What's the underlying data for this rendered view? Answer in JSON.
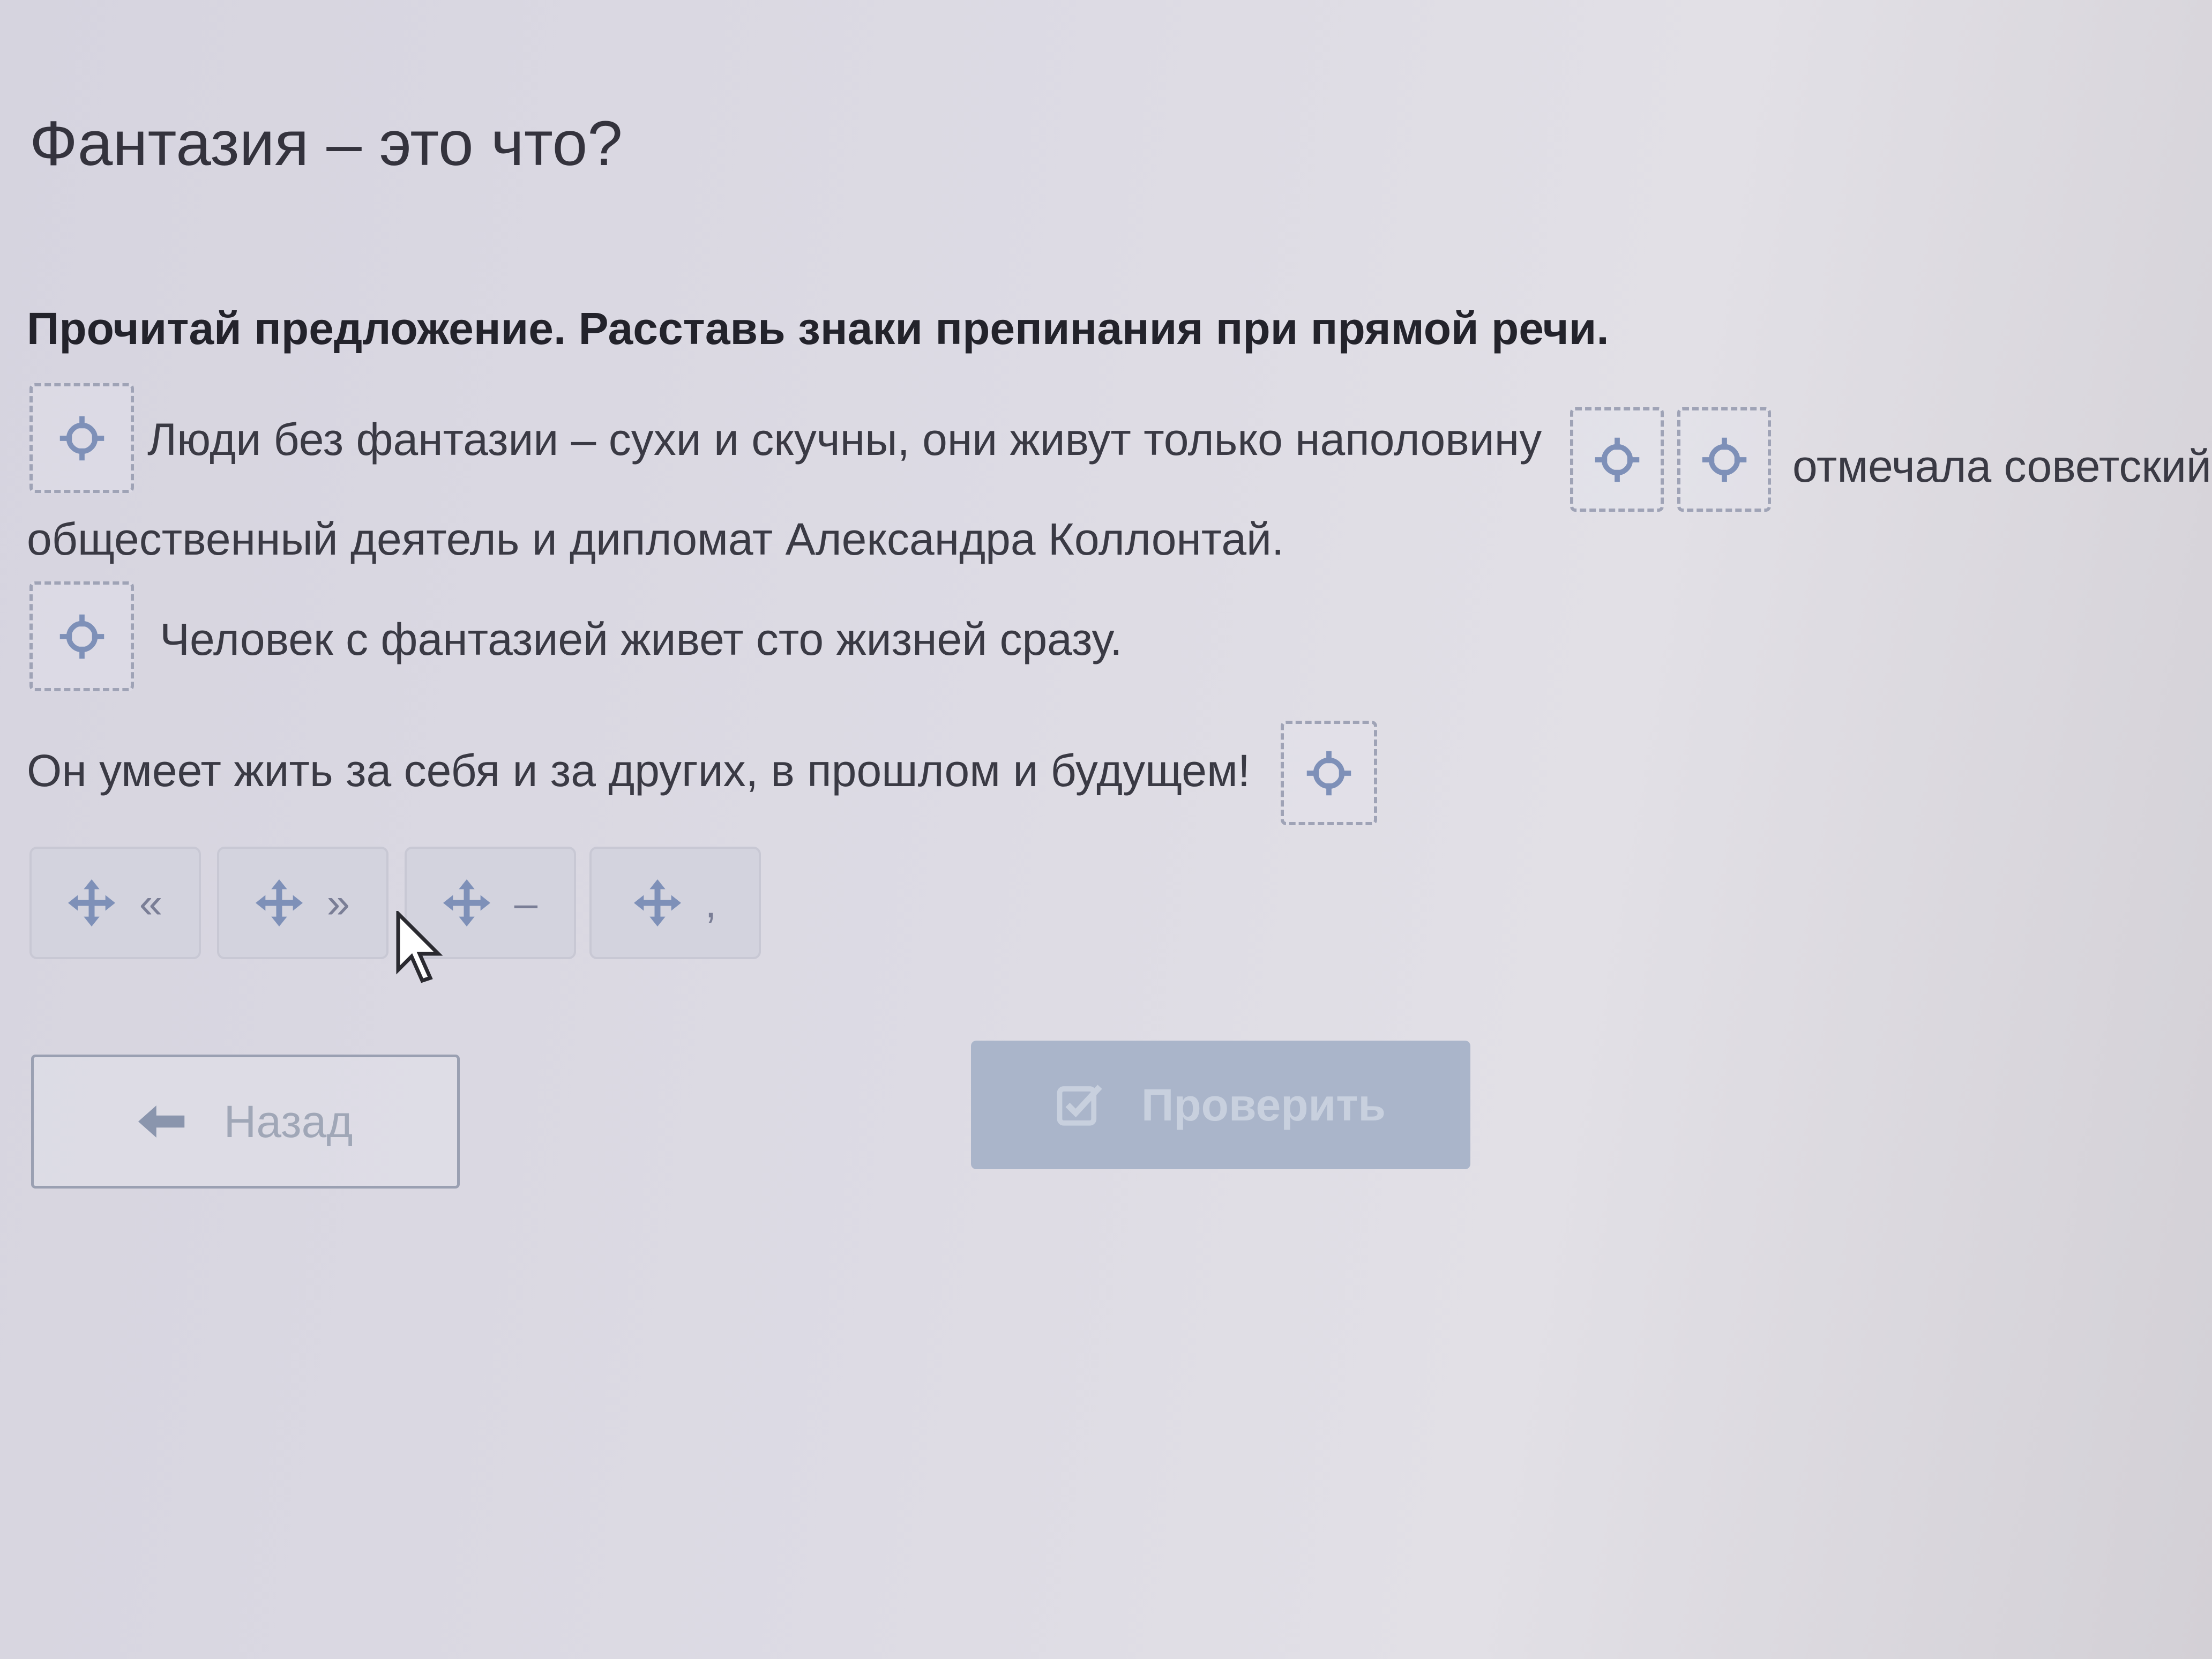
{
  "page": {
    "title": "Фантазия – это что?",
    "instruction": "Прочитай предложение. Расставь знаки препинания при прямой речи."
  },
  "sentence": {
    "line1": "Люди без фантазии – сухи и скучны, они живут только наполовину",
    "line1_after": "отмечала советский",
    "line2": "общественный деятель и дипломат Александра Коллонтай.",
    "line3": "Человек с фантазией живет сто жизней сразу.",
    "line4": "Он умеет жить за себя и за других, в прошлом и будущем!"
  },
  "dropzones": [
    "target-icon",
    "target-icon",
    "target-icon",
    "target-icon",
    "target-icon"
  ],
  "tokens": [
    {
      "icon": "move-icon",
      "symbol": "«"
    },
    {
      "icon": "move-icon",
      "symbol": "»"
    },
    {
      "icon": "move-icon",
      "symbol": "–"
    },
    {
      "icon": "move-icon",
      "symbol": ","
    }
  ],
  "buttons": {
    "back": {
      "label": "Назад",
      "icon": "arrow-left-icon"
    },
    "check": {
      "label": "Проверить",
      "icon": "checkbox-icon"
    }
  },
  "colors": {
    "background": "#dcdae3",
    "icon_blue": "#7e90b8",
    "check_button": "#aab5ca",
    "token_bg": "#d3d3de"
  }
}
